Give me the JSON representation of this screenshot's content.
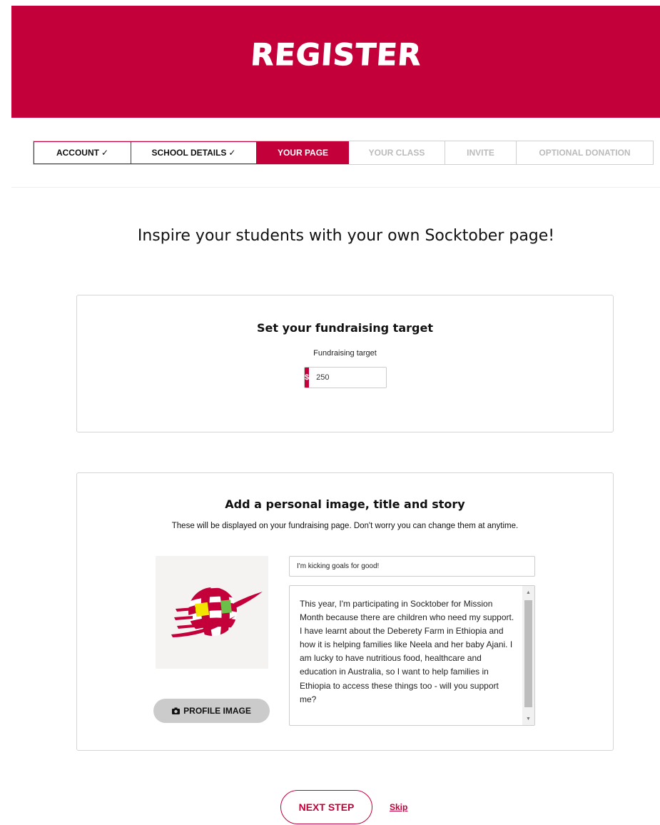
{
  "header": {
    "title": "REGISTER"
  },
  "steps": [
    {
      "label": "ACCOUNT",
      "check": "✓",
      "state": "done"
    },
    {
      "label": "SCHOOL DETAILS",
      "check": "✓",
      "state": "done"
    },
    {
      "label": "YOUR PAGE",
      "state": "active"
    },
    {
      "label": "YOUR CLASS",
      "state": "upcoming"
    },
    {
      "label": "INVITE",
      "state": "upcoming"
    },
    {
      "label": "OPTIONAL DONATION",
      "state": "upcoming"
    }
  ],
  "headline": "Inspire your students with your own Socktober page!",
  "target_card": {
    "title": "Set your fundraising target",
    "field_label": "Fundraising target",
    "currency_symbol": "$",
    "value": "250"
  },
  "story_card": {
    "title": "Add a personal image, title and story",
    "subtitle": "These will be displayed on your fundraising page. Don't worry you can change them at anytime.",
    "profile_button_label": "PROFILE IMAGE",
    "page_title_value": "I'm kicking goals for good!",
    "story_text": "This year, I'm participating in Socktober for Mission Month because there are children who need my support. I have learnt about the Deberety Farm in Ethiopia and how it is helping families like Neela and her baby Ajani. I am lucky to have nutritious food, healthcare and education in Australia, so I want to help families in Ethiopia to access these things too - will you support me?"
  },
  "footer": {
    "next_label": "NEXT STEP",
    "skip_label": "Skip"
  },
  "colors": {
    "brand": "#c4003a",
    "logo_yellow": "#f2e600",
    "logo_green": "#6cc04a"
  },
  "icons": {
    "camera": "camera-icon",
    "logo": "socktober-globe-logo"
  }
}
